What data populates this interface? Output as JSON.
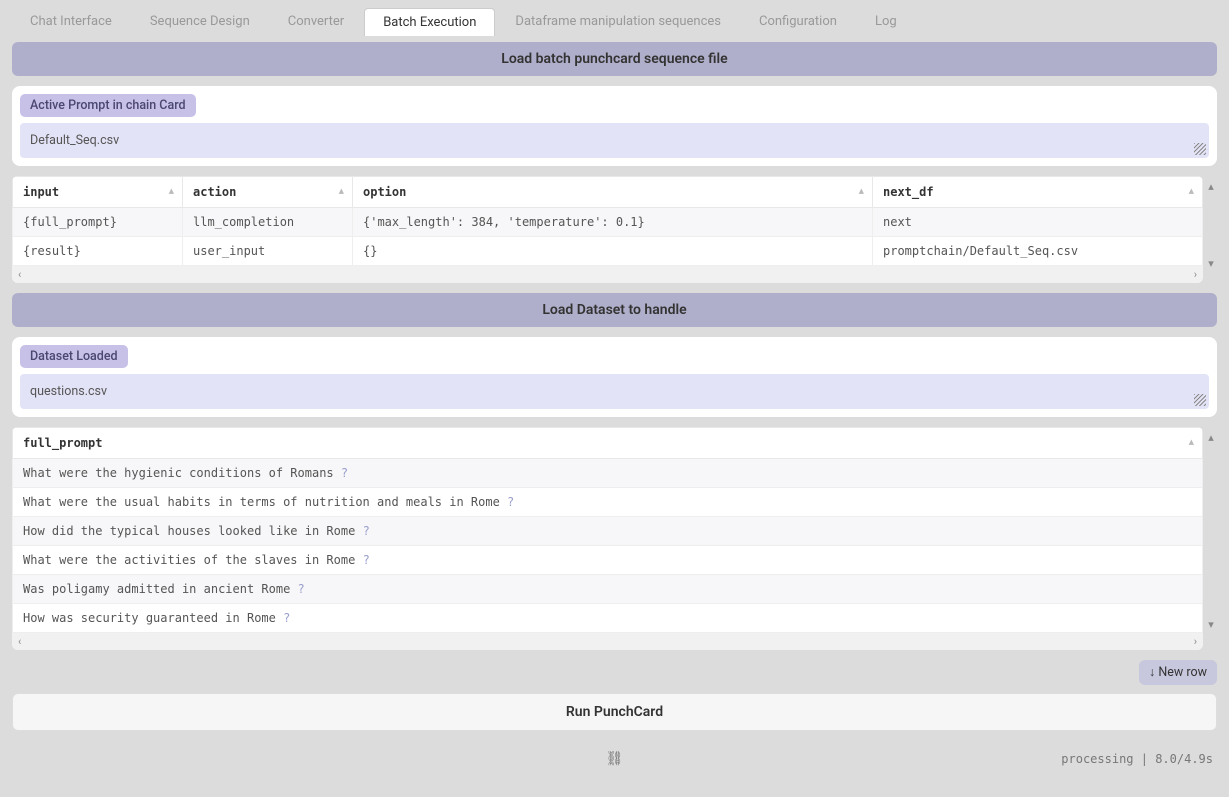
{
  "tabs": [
    {
      "label": "Chat Interface"
    },
    {
      "label": "Sequence Design"
    },
    {
      "label": "Converter"
    },
    {
      "label": "Batch Execution",
      "active": true
    },
    {
      "label": "Dataframe manipulation sequences"
    },
    {
      "label": "Configuration"
    },
    {
      "label": "Log"
    }
  ],
  "section1": {
    "button": "Load batch punchcard sequence file",
    "badge": "Active Prompt in chain Card",
    "value": "Default_Seq.csv"
  },
  "table1": {
    "columns": [
      "input",
      "action",
      "option",
      "next_df"
    ],
    "rows": [
      {
        "input": "{full_prompt}",
        "action": "llm_completion",
        "option": "{'max_length': 384, 'temperature': 0.1}",
        "next_df": "next"
      },
      {
        "input": "{result}",
        "action": "user_input",
        "option": "{}",
        "next_df": "promptchain/Default_Seq.csv"
      }
    ]
  },
  "section2": {
    "button": "Load Dataset to handle",
    "badge": "Dataset Loaded",
    "value": "questions.csv"
  },
  "table2": {
    "column": "full_prompt",
    "rows": [
      "What were the hygienic conditions of Romans ?",
      "What were the usual habits in terms of nutrition and meals in Rome ?",
      "How did the typical houses looked like in Rome ?",
      "What were the activities of the slaves in Rome ?",
      "Was poligamy admitted in ancient Rome ?",
      "How was security guaranteed in Rome ?"
    ]
  },
  "newrow": "↓ New row",
  "run": "Run PunchCard",
  "footer": {
    "status_left": "processing",
    "status_right": "8.0/4.9s"
  }
}
